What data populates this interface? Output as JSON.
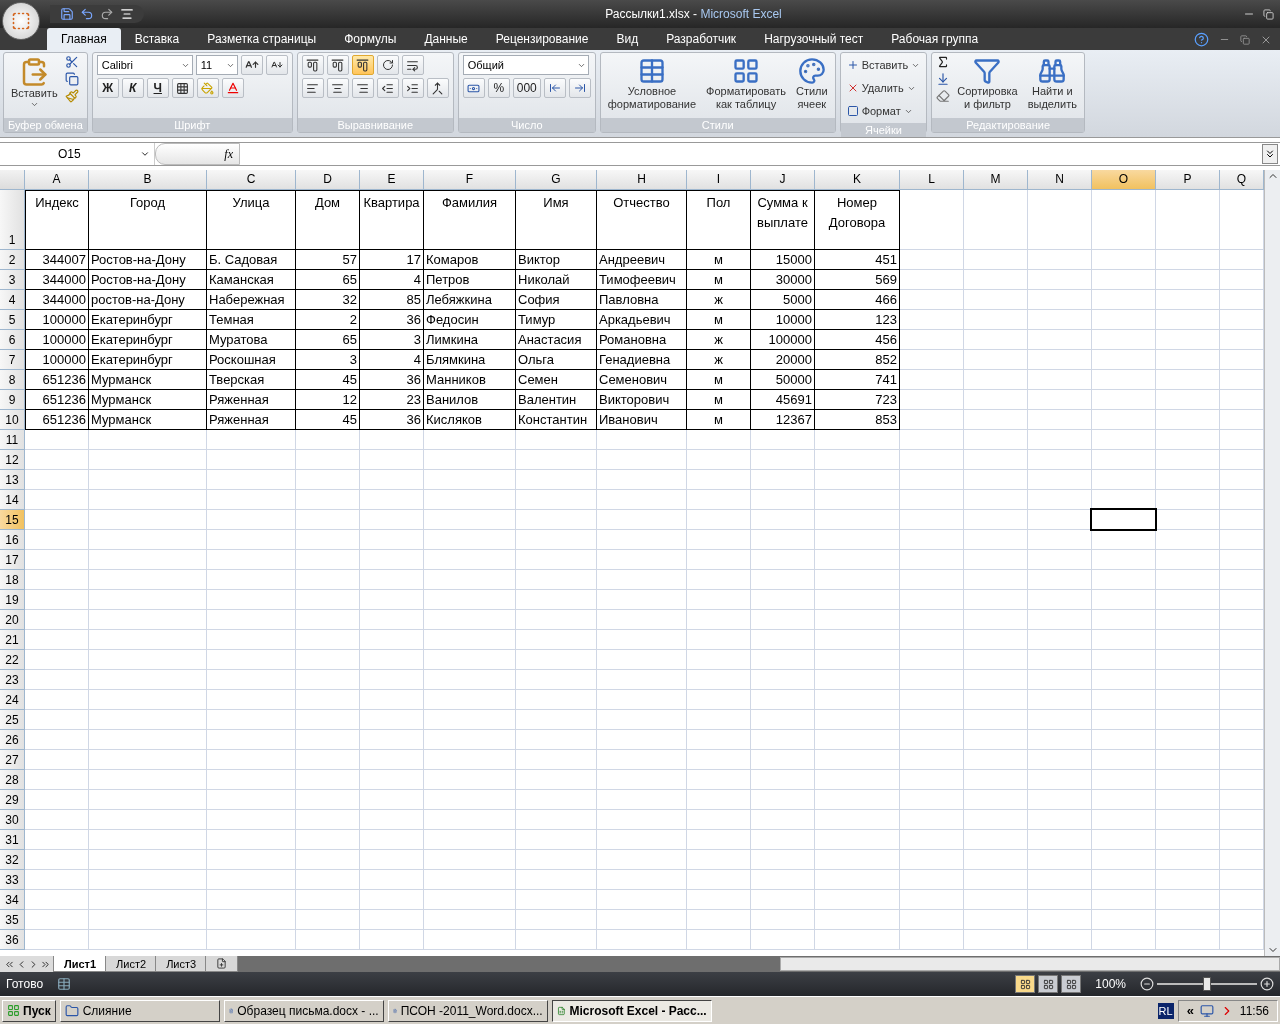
{
  "window": {
    "document": "Рассылки1.xlsx",
    "separator": "-",
    "app": "Microsoft Excel"
  },
  "tabs": [
    {
      "label": "Главная",
      "selected": true
    },
    {
      "label": "Вставка",
      "selected": false
    },
    {
      "label": "Разметка страницы",
      "selected": false
    },
    {
      "label": "Формулы",
      "selected": false
    },
    {
      "label": "Данные",
      "selected": false
    },
    {
      "label": "Рецензирование",
      "selected": false
    },
    {
      "label": "Вид",
      "selected": false
    },
    {
      "label": "Разработчик",
      "selected": false
    },
    {
      "label": "Нагрузочный тест",
      "selected": false
    },
    {
      "label": "Рабочая группа",
      "selected": false
    }
  ],
  "ribbon": {
    "groups": [
      {
        "kind": "clipboard",
        "label": "Буфер обмена",
        "paste": "Вставить"
      },
      {
        "kind": "font",
        "label": "Шрифт",
        "font": "Calibri",
        "size": "11",
        "bold": "Ж",
        "italic": "К",
        "underline": "Ч"
      },
      {
        "kind": "alignment",
        "label": "Выравнивание",
        "vertical": [
          {
            "selected": false
          },
          {
            "selected": false
          },
          {
            "selected": true
          }
        ]
      },
      {
        "kind": "number",
        "label": "Число",
        "format": "Общий",
        "percent": "%",
        "thousands": "000"
      },
      {
        "kind": "styles",
        "label": "Стили",
        "buttons": [
          "Условное\nформатирование",
          "Форматировать\nкак таблицу",
          "Стили\nячеек"
        ]
      },
      {
        "kind": "cells",
        "label": "Ячейки",
        "buttons": [
          "Вставить",
          "Удалить",
          "Формат"
        ]
      },
      {
        "kind": "editing",
        "label": "Редактирование",
        "buttons": [
          "Сортировка\nи фильтр",
          "Найти и\nвыделить"
        ]
      }
    ]
  },
  "formula_bar": {
    "name_box": "O15",
    "function_button": "fx"
  },
  "table": {
    "columns": [
      {
        "letter": "A",
        "kind": "numeric",
        "selected": false
      },
      {
        "letter": "B",
        "kind": "text",
        "selected": false
      },
      {
        "letter": "C",
        "kind": "text",
        "selected": false
      },
      {
        "letter": "D",
        "kind": "numeric",
        "selected": false
      },
      {
        "letter": "E",
        "kind": "numeric",
        "selected": false
      },
      {
        "letter": "F",
        "kind": "text",
        "selected": false
      },
      {
        "letter": "G",
        "kind": "text",
        "selected": false
      },
      {
        "letter": "H",
        "kind": "text",
        "selected": false
      },
      {
        "letter": "I",
        "kind": "centered",
        "selected": false
      },
      {
        "letter": "J",
        "kind": "numeric",
        "selected": false
      },
      {
        "letter": "K",
        "kind": "numeric",
        "selected": false
      },
      {
        "letter": "L",
        "kind": "text",
        "selected": false
      },
      {
        "letter": "M",
        "kind": "text",
        "selected": false
      },
      {
        "letter": "N",
        "kind": "text",
        "selected": false
      },
      {
        "letter": "O",
        "kind": "text",
        "selected": true
      },
      {
        "letter": "P",
        "kind": "text",
        "selected": false
      },
      {
        "letter": "Q",
        "kind": "text",
        "selected": false
      }
    ],
    "rows": [
      {
        "number": "1",
        "selected": false,
        "cells": [
          "Индекс",
          "Город",
          "Улица",
          "Дом",
          "Квартира",
          "Фамилия",
          "Имя",
          "Отчество",
          "Пол",
          "Сумма к выплате",
          "Номер Договора"
        ]
      },
      {
        "number": "2",
        "selected": false,
        "cells": [
          "344007",
          "Ростов-на-Дону",
          "Б. Садовая",
          "57",
          "17",
          "Комаров",
          "Виктор",
          "Андреевич",
          "м",
          "15000",
          "451"
        ]
      },
      {
        "number": "3",
        "selected": false,
        "cells": [
          "344000",
          "Ростов-на-Дону",
          "Каманская",
          "65",
          "4",
          "Петров",
          "Николай",
          "Тимофеевич",
          "м",
          "30000",
          "569"
        ]
      },
      {
        "number": "4",
        "selected": false,
        "cells": [
          "344000",
          "ростов-на-Дону",
          "Набережная",
          "32",
          "85",
          "Лебяжкина",
          "София",
          "Павловна",
          "ж",
          "5000",
          "466"
        ]
      },
      {
        "number": "5",
        "selected": false,
        "cells": [
          "100000",
          "Екатеринбург",
          "Темная",
          "2",
          "36",
          "Федосин",
          "Тимур",
          "Аркадьевич",
          "м",
          "10000",
          "123"
        ]
      },
      {
        "number": "6",
        "selected": false,
        "cells": [
          "100000",
          "Екатеринбург",
          "Муратова",
          "65",
          "3",
          "Лимкина",
          "Анастасия",
          "Романовна",
          "ж",
          "100000",
          "456"
        ]
      },
      {
        "number": "7",
        "selected": false,
        "cells": [
          "100000",
          "Екатеринбург",
          "Роскошная",
          "3",
          "4",
          "Блямкина",
          "Ольга",
          "Генадиевна",
          "ж",
          "20000",
          "852"
        ]
      },
      {
        "number": "8",
        "selected": false,
        "cells": [
          "651236",
          "Мурманск",
          "Тверская",
          "45",
          "36",
          "Манников",
          "Семен",
          "Семенович",
          "м",
          "50000",
          "741"
        ]
      },
      {
        "number": "9",
        "selected": false,
        "cells": [
          "651236",
          "Мурманск",
          "Ряженная",
          "12",
          "23",
          "Ванилов",
          "Валентин",
          "Викторович",
          "м",
          "45691",
          "723"
        ]
      },
      {
        "number": "10",
        "selected": false,
        "cells": [
          "651236",
          "Мурманск",
          "Ряженная",
          "45",
          "36",
          "Кисляков",
          "Константин",
          "Иванович",
          "м",
          "12367",
          "853"
        ]
      },
      {
        "number": "11",
        "selected": false
      },
      {
        "number": "12",
        "selected": false
      },
      {
        "number": "13",
        "selected": false
      },
      {
        "number": "14",
        "selected": false
      },
      {
        "number": "15",
        "selected": true
      },
      {
        "number": "16",
        "selected": false
      },
      {
        "number": "17",
        "selected": false
      },
      {
        "number": "18",
        "selected": false
      },
      {
        "number": "19",
        "selected": false
      },
      {
        "number": "20",
        "selected": false
      },
      {
        "number": "21",
        "selected": false
      },
      {
        "number": "22",
        "selected": false
      },
      {
        "number": "23",
        "selected": false
      },
      {
        "number": "24",
        "selected": false
      },
      {
        "number": "25",
        "selected": false
      },
      {
        "number": "26",
        "selected": false
      },
      {
        "number": "27",
        "selected": false
      },
      {
        "number": "28",
        "selected": false
      },
      {
        "number": "29",
        "selected": false
      },
      {
        "number": "30",
        "selected": false
      },
      {
        "number": "31",
        "selected": false
      },
      {
        "number": "32",
        "selected": false
      },
      {
        "number": "33",
        "selected": false
      },
      {
        "number": "34",
        "selected": false
      },
      {
        "number": "35",
        "selected": false
      },
      {
        "number": "36",
        "selected": false
      }
    ]
  },
  "sheet_tabs": [
    {
      "label": "Лист1",
      "selected": true
    },
    {
      "label": "Лист2",
      "selected": false
    },
    {
      "label": "Лист3",
      "selected": false
    }
  ],
  "status_bar": {
    "status": "Готово",
    "views": [
      {
        "selected": true
      },
      {
        "selected": false
      },
      {
        "selected": false
      }
    ],
    "zoom": "100%",
    "zoom_slider": {
      "level": 0.5
    }
  },
  "taskbar": {
    "start": "Пуск",
    "items": [
      {
        "kind": "folder",
        "label": "Слияние",
        "selected": false
      },
      {
        "kind": "word",
        "label": "Образец письма.docx - ...",
        "selected": false
      },
      {
        "kind": "word",
        "label": "ПСОН -2011_Word.docx...",
        "selected": false
      },
      {
        "kind": "excel",
        "label": "Microsoft Excel - Расс...",
        "selected": true
      }
    ],
    "language": "RL",
    "tray_toggle": "«",
    "time": "11:56"
  }
}
